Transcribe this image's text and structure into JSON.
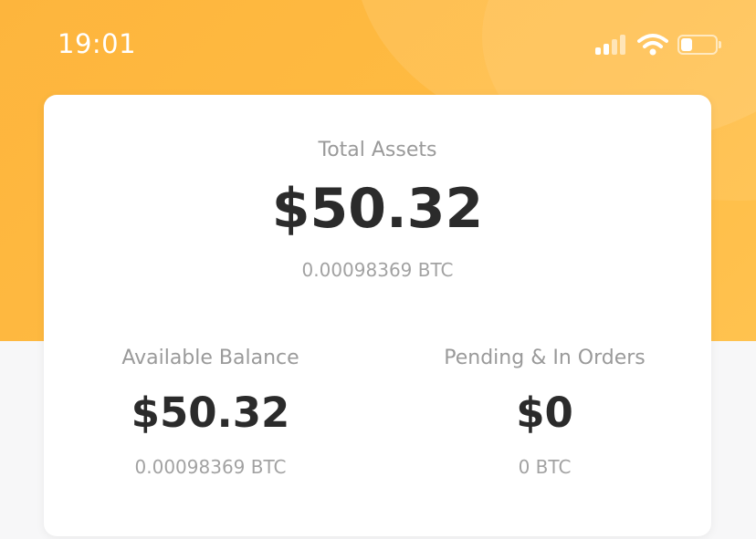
{
  "status_bar": {
    "time": "19:01"
  },
  "colors": {
    "header_accent": "#FDB53D",
    "card_background": "#FFFFFF",
    "primary_text": "#2B2B2B",
    "secondary_text": "#9A9A9A"
  },
  "total_assets": {
    "label": "Total Assets",
    "value": "$50.32",
    "btc": "0.00098369 BTC"
  },
  "available_balance": {
    "label": "Available Balance",
    "value": "$50.32",
    "btc": "0.00098369 BTC"
  },
  "pending_in_orders": {
    "label": "Pending & In Orders",
    "value": "$0",
    "btc": "0 BTC"
  },
  "icons": {
    "signal": "cellular-signal-icon",
    "wifi": "wifi-icon",
    "battery": "battery-icon"
  }
}
